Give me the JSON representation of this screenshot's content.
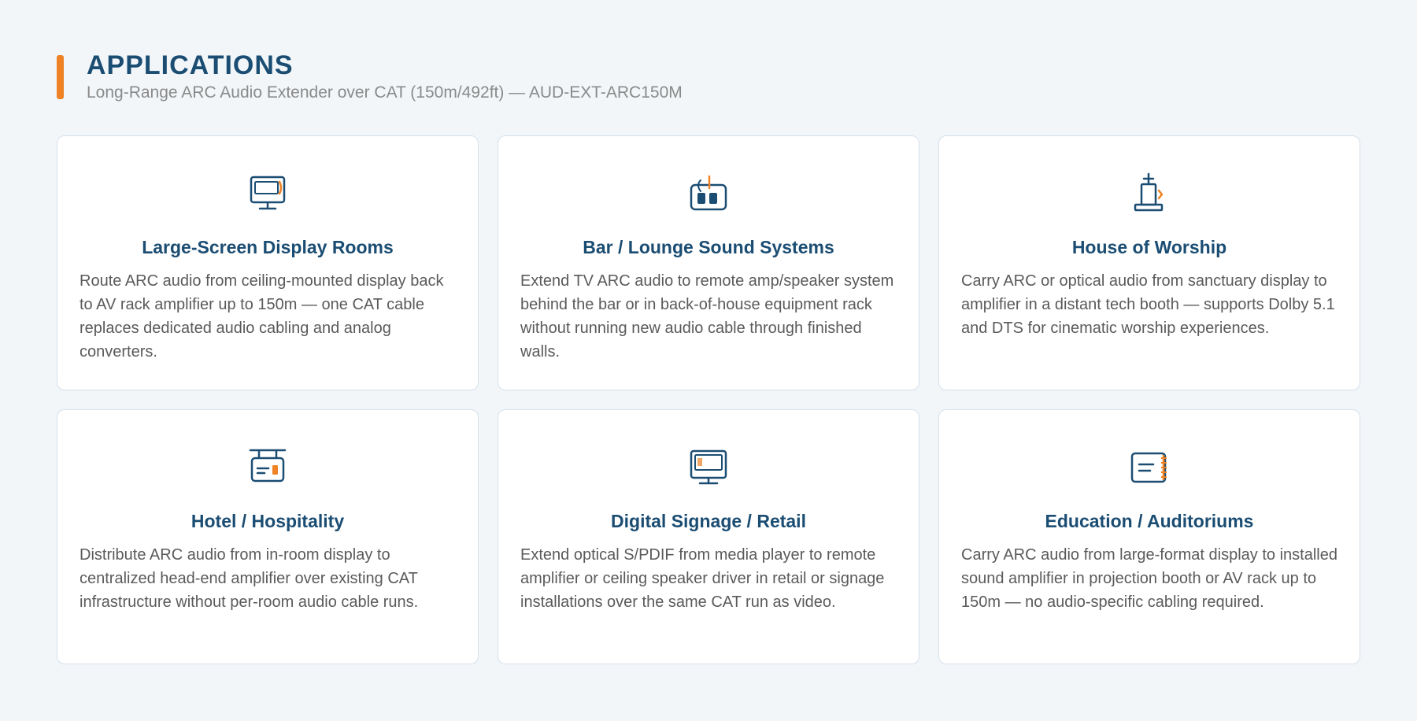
{
  "header": {
    "title": "APPLICATIONS",
    "subtitle": "Long-Range ARC Audio Extender over CAT (150m/492ft) — AUD-EXT-ARC150M"
  },
  "colors": {
    "accent": "#ef8224",
    "primary": "#1b4d73",
    "text": "#5a5a5a",
    "background": "#f2f6f9"
  },
  "cards": [
    {
      "icon": "display-tv-icon",
      "title": "Large-Screen Display Rooms",
      "text": "Route ARC audio from ceiling-mounted display back to AV rack amplifier up to 150m — one CAT cable replaces dedicated audio cabling and analog converters."
    },
    {
      "icon": "radio-speaker-icon",
      "title": "Bar / Lounge Sound Systems",
      "text": "Extend TV ARC audio to remote amp/speaker system behind the bar or in back-of-house equipment rack without running new audio cable through finished walls."
    },
    {
      "icon": "church-icon",
      "title": "House of Worship",
      "text": "Carry ARC or optical audio from sanctuary display to amplifier in a distant tech booth — supports Dolby 5.1 and DTS for cinematic worship experiences."
    },
    {
      "icon": "hotel-sign-icon",
      "title": "Hotel / Hospitality",
      "text": "Distribute ARC audio from in-room display to centralized head-end amplifier over existing CAT infrastructure without per-room audio cable runs."
    },
    {
      "icon": "signage-monitor-icon",
      "title": "Digital Signage / Retail",
      "text": "Extend optical S/PDIF from media player to remote amplifier or ceiling speaker driver in retail or signage installations over the same CAT run as video."
    },
    {
      "icon": "notebook-icon",
      "title": "Education / Auditoriums",
      "text": "Carry ARC audio from large-format display to installed sound amplifier in projection booth or AV rack up to 150m — no audio-specific cabling required."
    }
  ]
}
